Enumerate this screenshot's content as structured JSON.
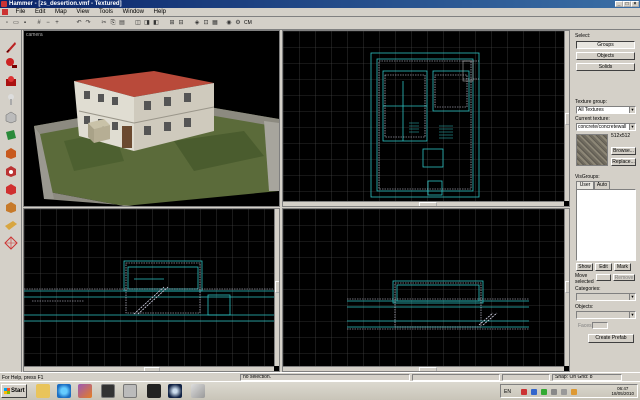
{
  "window": {
    "title": "Hammer - [zs_desertion.vmf - Textured]"
  },
  "menu": {
    "items": [
      "File",
      "Edit",
      "Map",
      "View",
      "Tools",
      "Window",
      "Help"
    ]
  },
  "toolbar": {
    "cm_label": "CM"
  },
  "viewports": {
    "camera_label": "camera"
  },
  "right_panel": {
    "select_label": "Select:",
    "groups_label": "Groups",
    "objects_label": "Objects",
    "solids_label": "Solids",
    "texture_group_label": "Texture group:",
    "texture_group_value": "All Textures",
    "current_texture_label": "Current texture:",
    "current_texture_value": "concrete/concretewall",
    "texture_size": "512x512",
    "browse_label": "Browse...",
    "replace_label": "Replace...",
    "visgroups_label": "VisGroups:",
    "tab_user": "User",
    "tab_auto": "Auto",
    "show_label": "Show",
    "edit_label": "Edit",
    "mark_label": "Mark",
    "move_selected_label": "Move\nselected",
    "remove_label": "Remove",
    "categories_label": "Categories:",
    "objects2_label": "Objects:",
    "faces_label": "Faces:",
    "create_prefab_label": "Create Prefab"
  },
  "status": {
    "help": "For Help, press F1",
    "selection": "no selection.",
    "snap": "Snap: On Grid: 8"
  },
  "taskbar": {
    "start_label": "Start",
    "lang": "EN",
    "time": "06:47",
    "date": "18/05/2010"
  }
}
